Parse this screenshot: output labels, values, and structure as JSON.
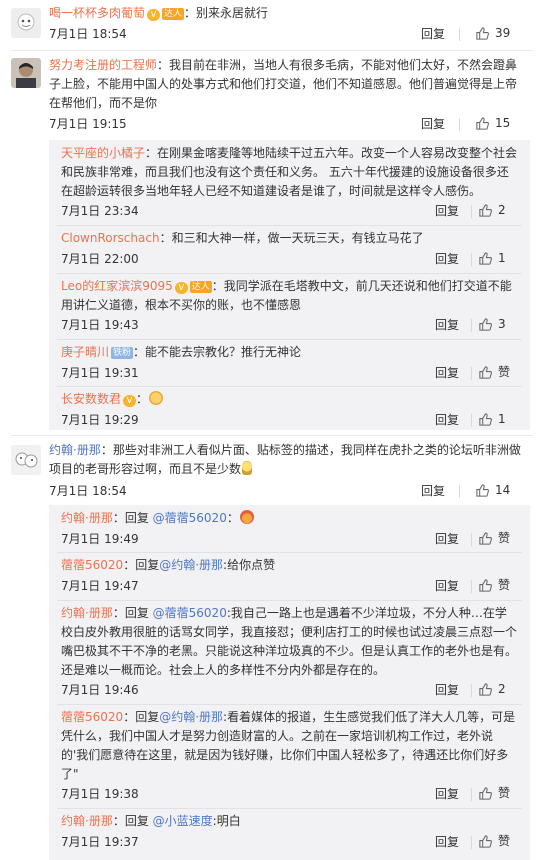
{
  "ui": {
    "reply_label": "回复",
    "like_label_zan": "赞"
  },
  "c1": {
    "name": "喝一杯杯多肉葡萄",
    "badge": "达人",
    "text": "：别来永居就行",
    "time": "7月1日 18:54",
    "likes": "39"
  },
  "c2": {
    "name": "努力考注册的工程师",
    "text": "：我目前在非洲，当地人有很多毛病，不能对他们太好，不然会蹬鼻子上脸，不能用中国人的处事方式和他们打交道，他们不知道感恩。他们普遍觉得是上帝在帮他们，而不是你",
    "time": "7月1日 19:15",
    "likes": "15",
    "replies": [
      {
        "name": "天平座的小橘子",
        "text": "：在刚果金喀麦隆等地陆续干过五六年。改变一个人容易改变整个社会和民族非常难，而且我们也没有这个责任和义务。 五六十年代援建的设施设备很多还在超龄运转很多当地年轻人已经不知道建设者是谁了，时间就是这样令人感伤。",
        "time": "7月1日 23:34",
        "likes": "2"
      },
      {
        "name": "ClownRorschach",
        "text": "：和三和大神一样，做一天玩三天，有钱立马花了",
        "time": "7月1日 22:00",
        "likes": "1"
      },
      {
        "name": "Leo的红家滨滨9095",
        "badge": "达人",
        "text": "：我同学派在毛塔教中文，前几天还说和他们打交道不能用讲仁义道德，根本不买你的账，也不懂感恩",
        "time": "7月1日 19:43",
        "likes": "3"
      },
      {
        "name": "庚子晴川",
        "badge": "铁粉",
        "text": "：能不能去宗教化？推行无神论",
        "time": "7月1日 19:31",
        "likes": "赞"
      },
      {
        "name": "长安数数君",
        "text": "：",
        "time": "7月1日 19:29",
        "likes": "1"
      }
    ]
  },
  "c3": {
    "name": "约翰·册那",
    "text": "：那些对非洲工人看似片面、贴标签的描述，我同样在虎扑之类的论坛听非洲做项目的老哥形容过啊，而且不是少数",
    "time": "7月1日 18:54",
    "likes": "14",
    "replies": [
      {
        "name": "约翰·册那",
        "pre": "：回复 ",
        "at": "@蓿蓿56020",
        "text": "：",
        "time": "7月1日 19:49",
        "likes": "赞"
      },
      {
        "name": "蓿蓿56020",
        "pre": "：回复",
        "at": "@约翰·册那",
        "text": ":给你点赞",
        "time": "7月1日 19:47",
        "likes": "赞"
      },
      {
        "name": "约翰·册那",
        "pre": "：回复 ",
        "at": "@蓿蓿56020",
        "text": ":我自己一路上也是遇着不少洋垃圾，不分人种…在学校白皮外教用很脏的话骂女同学，我直接怼；便利店打工的时候也试过凌晨三点怼一个嘴巴极其不干不净的老黑。只能说这种洋垃圾真的不少。但是认真工作的老外也是有。还是难以一概而论。社会上人的多样性不分内外都是存在的。",
        "time": "7月1日 19:46",
        "likes": "2"
      },
      {
        "name": "蓿蓿56020",
        "pre": "：回复",
        "at": "@约翰·册那",
        "text": ":看着媒体的报道，生生感觉我们低了洋大人几等，可是凭什么，我们中国人才是努力创造财富的人。之前在一家培训机构工作过，老外说的'我们愿意待在这里，就是因为钱好赚，比你们中国人轻松多了，待遇还比你们好多了\"",
        "time": "7月1日 19:38",
        "likes": "赞"
      },
      {
        "name": "约翰·册那",
        "pre": "：回复 ",
        "at": "@小蓝速度",
        "text": ":明白",
        "time": "7月1日 19:37",
        "likes": "赞"
      }
    ]
  }
}
